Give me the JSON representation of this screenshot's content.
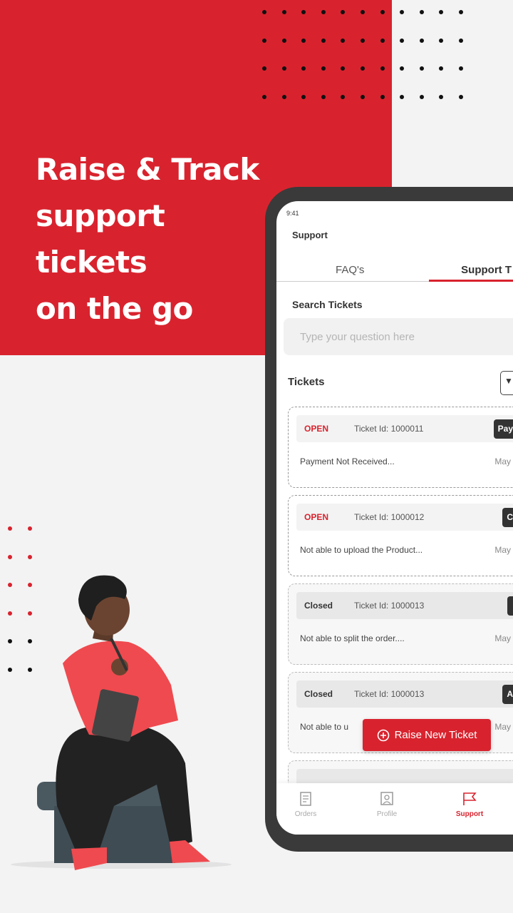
{
  "headline": [
    "Raise & Track",
    "support",
    "tickets",
    "on the go"
  ],
  "colors": {
    "brand": "#d8232e",
    "dark": "#333333"
  },
  "phone": {
    "status_time": "9:41",
    "title": "Support",
    "tabs": [
      {
        "label": "FAQ's",
        "active": false
      },
      {
        "label": "Support T",
        "active": true
      }
    ],
    "search": {
      "label": "Search Tickets",
      "placeholder": "Type your question here"
    },
    "tickets_label": "Tickets",
    "filter_icon": "filter-icon",
    "tickets": [
      {
        "status": "OPEN",
        "id": "Ticket Id: 1000011",
        "tag": "Pay",
        "desc": "Payment Not Received...",
        "date": "May"
      },
      {
        "status": "OPEN",
        "id": "Ticket Id: 1000012",
        "tag": "C",
        "desc": "Not able to upload the Product...",
        "date": "May"
      },
      {
        "status": "Closed",
        "id": "Ticket Id: 1000013",
        "tag": "",
        "desc": "Not able to split the order....",
        "date": "May"
      },
      {
        "status": "Closed",
        "id": "Ticket Id: 1000013",
        "tag": "A",
        "desc": "Not able to u",
        "date": "May"
      }
    ],
    "fab_label": "Raise New Ticket",
    "nav": [
      {
        "label": "Orders",
        "icon": "document-icon"
      },
      {
        "label": "Profile",
        "icon": "profile-icon"
      },
      {
        "label": "Support",
        "icon": "flag-icon",
        "active": true
      }
    ]
  }
}
